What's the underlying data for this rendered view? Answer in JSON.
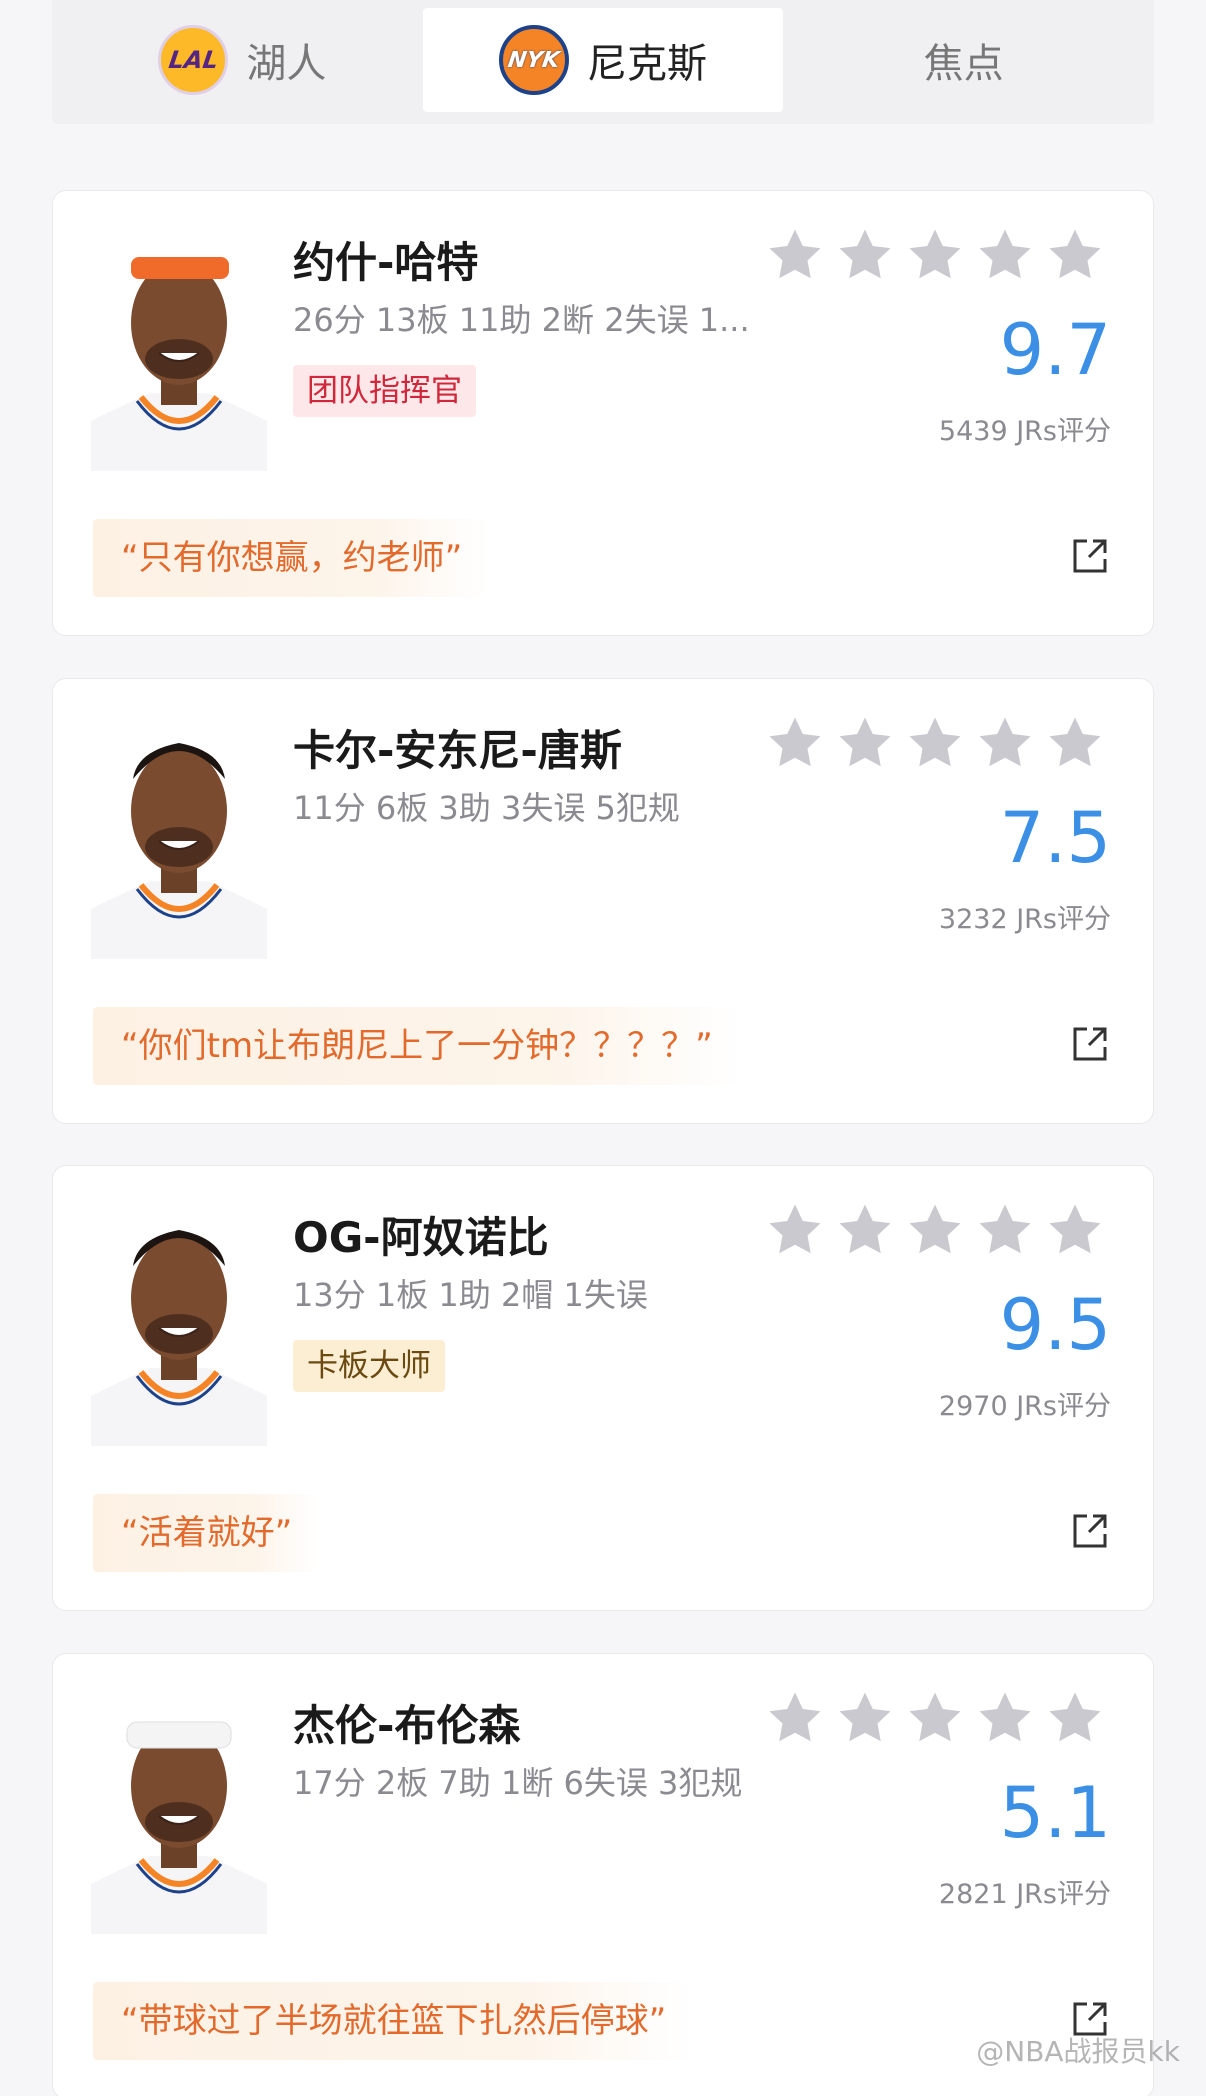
{
  "tabs": [
    {
      "label": "湖人",
      "logo_text": "LAL",
      "icon": "lakers-logo-icon",
      "active": false
    },
    {
      "label": "尼克斯",
      "logo_text": "NYK",
      "icon": "knicks-logo-icon",
      "active": true
    },
    {
      "label": "焦点",
      "active": false
    }
  ],
  "players": [
    {
      "name": "约什-哈特",
      "stats": "26分 13板 11助 2断 2失误 1...",
      "badge": "团队指挥官",
      "badge_color": "#d0283a",
      "rating": "9.7",
      "votes": "5439 JRs评分",
      "stars": 5,
      "quote": "“只有你想赢，约老师”",
      "headwear": "orange-headband"
    },
    {
      "name": "卡尔-安东尼-唐斯",
      "stats": "11分 6板 3助 3失误 5犯规",
      "badge": "",
      "rating": "7.5",
      "votes": "3232 JRs评分",
      "stars": 5,
      "quote": "“你们tm让布朗尼上了一分钟？？？？”",
      "headwear": "none"
    },
    {
      "name": "OG-阿奴诺比",
      "stats": "13分 1板 1助 2帽 1失误",
      "badge": "卡板大师",
      "badge_color": "#6b4a12",
      "rating": "9.5",
      "votes": "2970 JRs评分",
      "stars": 5,
      "quote": "“活着就好”",
      "headwear": "none"
    },
    {
      "name": "杰伦-布伦森",
      "stats": "17分 2板 7助 1断 6失误 3犯规",
      "badge": "",
      "rating": "5.1",
      "votes": "2821 JRs评分",
      "stars": 5,
      "quote": "“带球过了半场就往篮下扎然后停球”",
      "headwear": "white-headband"
    }
  ],
  "watermark": "@NBA战报员kk",
  "colors": {
    "rating": "#3b8fe5",
    "quote": "#e26a2c",
    "star": "#c9c9cf"
  }
}
